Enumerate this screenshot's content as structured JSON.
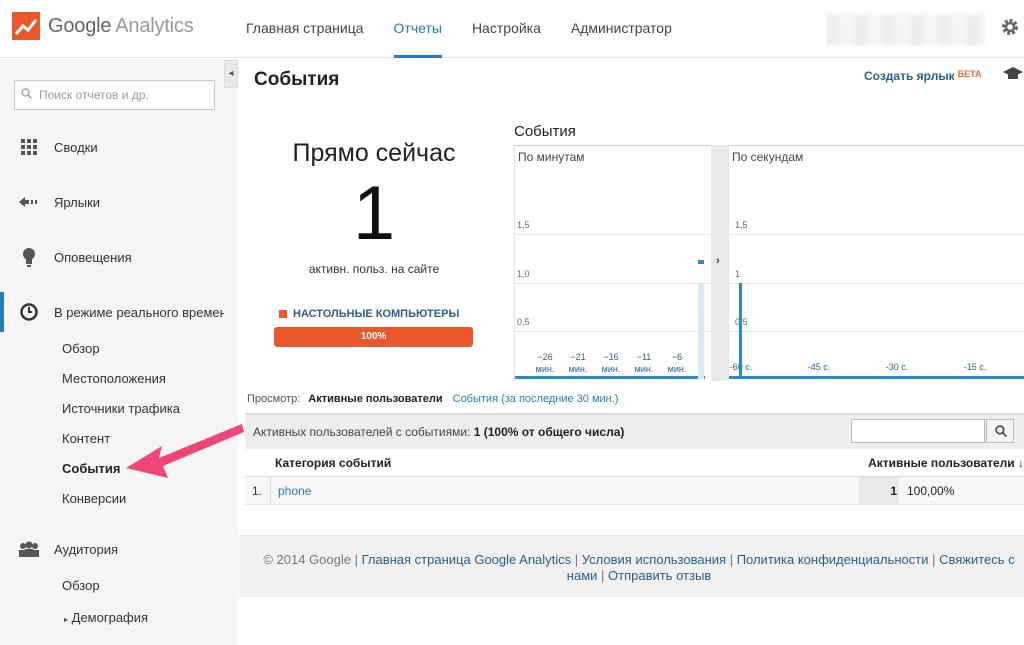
{
  "header": {
    "brand": {
      "google": "Google",
      "analytics": "Analytics"
    },
    "nav": [
      "Главная страница",
      "Отчеты",
      "Настройка",
      "Администратор"
    ],
    "active_nav": "Отчеты"
  },
  "sidebar": {
    "search_placeholder": "Поиск отчетов и др.",
    "items": [
      {
        "label": "Сводки",
        "icon": "grid-icon"
      },
      {
        "label": "Ярлыки",
        "icon": "shortcut-arrow-icon"
      },
      {
        "label": "Оповещения",
        "icon": "lightbulb-icon"
      },
      {
        "label": "В режиме реального времени",
        "icon": "clock-icon"
      },
      {
        "label": "Аудитория",
        "icon": "people-icon"
      }
    ],
    "realtime_sub": [
      "Обзор",
      "Местоположения",
      "Источники трафика",
      "Контент",
      "События",
      "Конверсии"
    ],
    "audience_sub": [
      "Обзор",
      "Демография"
    ],
    "selected": "События"
  },
  "main": {
    "title": "События",
    "create_shortcut": "Создать ярлык",
    "beta": "БЕТА",
    "right_now": {
      "heading": "Прямо сейчас",
      "value": "1",
      "subtitle": "активн. польз. на сайте",
      "device_label": "НАСТОЛЬНЫЕ КОМПЬЮТЕРЫ",
      "device_pct_text": "100%",
      "device_share": 1.0
    },
    "chart_heading": "События"
  },
  "chart_data": [
    {
      "type": "bar",
      "title": "По минутам",
      "y_ticks": [
        "0,5",
        "1,0",
        "1,5"
      ],
      "ylim": [
        0,
        2
      ],
      "x_ticks": [
        {
          "label": "−26",
          "unit": "мин."
        },
        {
          "label": "−21",
          "unit": "мин."
        },
        {
          "label": "−16",
          "unit": "мин."
        },
        {
          "label": "−11",
          "unit": "мин."
        },
        {
          "label": "−6",
          "unit": "мин."
        }
      ],
      "values_note_minutes": [
        -1
      ],
      "series": [
        {
          "values": [
            1
          ]
        }
      ]
    },
    {
      "type": "bar",
      "title": "По секундам",
      "y_ticks": [
        "0,5",
        "1",
        "1,5"
      ],
      "ylim": [
        0,
        2
      ],
      "x_ticks": [
        "-60 с.",
        "-45 с.",
        "-30 с.",
        "-15 с."
      ],
      "series": [
        {
          "values": [
            1
          ]
        }
      ]
    }
  ],
  "table": {
    "view_label": "Просмотр:",
    "view_active": "Активные пользователи",
    "view_link": "События (за последние 30 мин.)",
    "summary_prefix": "Активных пользователей с событиями:",
    "summary_value": "1 (100% от общего числа)",
    "columns": [
      "Категория событий",
      "Активные пользователи"
    ],
    "rows": [
      {
        "n": "1.",
        "category": "phone",
        "users": "1",
        "pct": "100,00%"
      }
    ]
  },
  "footer": {
    "copyright": "© 2014 Google",
    "links": [
      "Главная страница Google Analytics",
      "Условия использования",
      "Политика конфиденциальности",
      "Свяжитесь с нами",
      "Отправить отзыв"
    ]
  },
  "colors": {
    "accent": "#2a7ab5",
    "orange": "#e8582b",
    "arrow": "#f0457a"
  }
}
